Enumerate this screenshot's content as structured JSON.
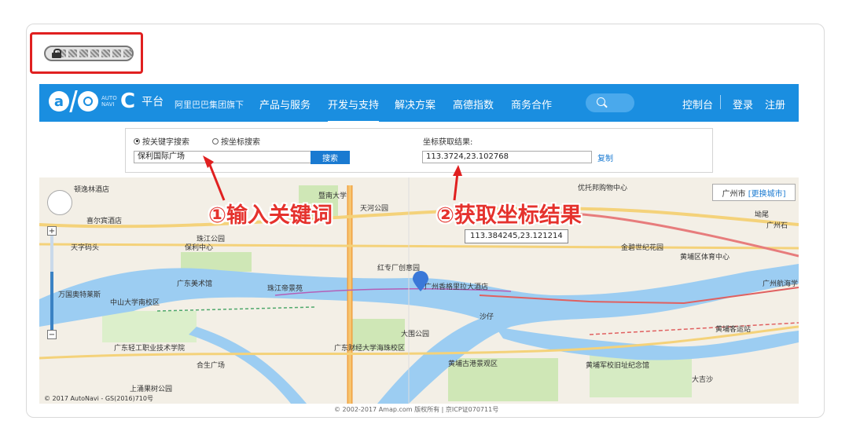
{
  "header": {
    "logo_letter": "a",
    "logo_sub": "AUTONAVI",
    "platform": "平台",
    "brand_subtitle": "阿里巴巴集团旗下",
    "nav": [
      "产品与服务",
      "开发与支持",
      "解决方案",
      "高德指数",
      "商务合作"
    ],
    "active_nav": "开发与支持",
    "right_links": [
      "控制台",
      "登录",
      "注册"
    ]
  },
  "controls": {
    "radio_keyword": "按关键字搜索",
    "radio_coord": "按坐标搜索",
    "keyword_value": "保利国际广场",
    "search_button": "搜索",
    "coord_label": "坐标获取结果:",
    "coord_value": "113.3724,23.102768",
    "copy_button": "复制"
  },
  "map": {
    "callout_1": "①输入关键词",
    "callout_2": "②获取坐标结果",
    "city": "广州市",
    "change_city": "[更换城市]",
    "tooltip_coord": "113.384245,23.121214",
    "zoom_level": 0.62,
    "labels": [
      "顿逸林酒店",
      "喜尔宾酒店",
      "天字码头",
      "保利中心",
      "万国奥特莱斯",
      "中山大学南校区",
      "广东美术馆",
      "珠江帝景苑",
      "暨南大学",
      "天河公园",
      "珠江公园",
      "红专厂创意园",
      "广州香格里拉大酒店",
      "优托邦购物中心",
      "金碧世纪花园",
      "黄埔区体育中心",
      "广州航海学",
      "大围公园",
      "广东财经大学海珠校区",
      "黄埔古港景观区",
      "黄埔军校旧址纪念馆",
      "广东轻工职业技术学院",
      "合生广场",
      "上涌果树公园",
      "沙仔",
      "大吉沙",
      "广州石",
      "坳尾",
      "黄埔客运站"
    ]
  },
  "footer": {
    "copyright": "© 2017 AutoNavi - GS(2016)710号",
    "bottom": "© 2002-2017 Amap.com 版权所有 | 京ICP证070711号"
  },
  "colors": {
    "brand": "#1a8ee0",
    "callout": "#e5322d",
    "highlight": "#e02020"
  }
}
